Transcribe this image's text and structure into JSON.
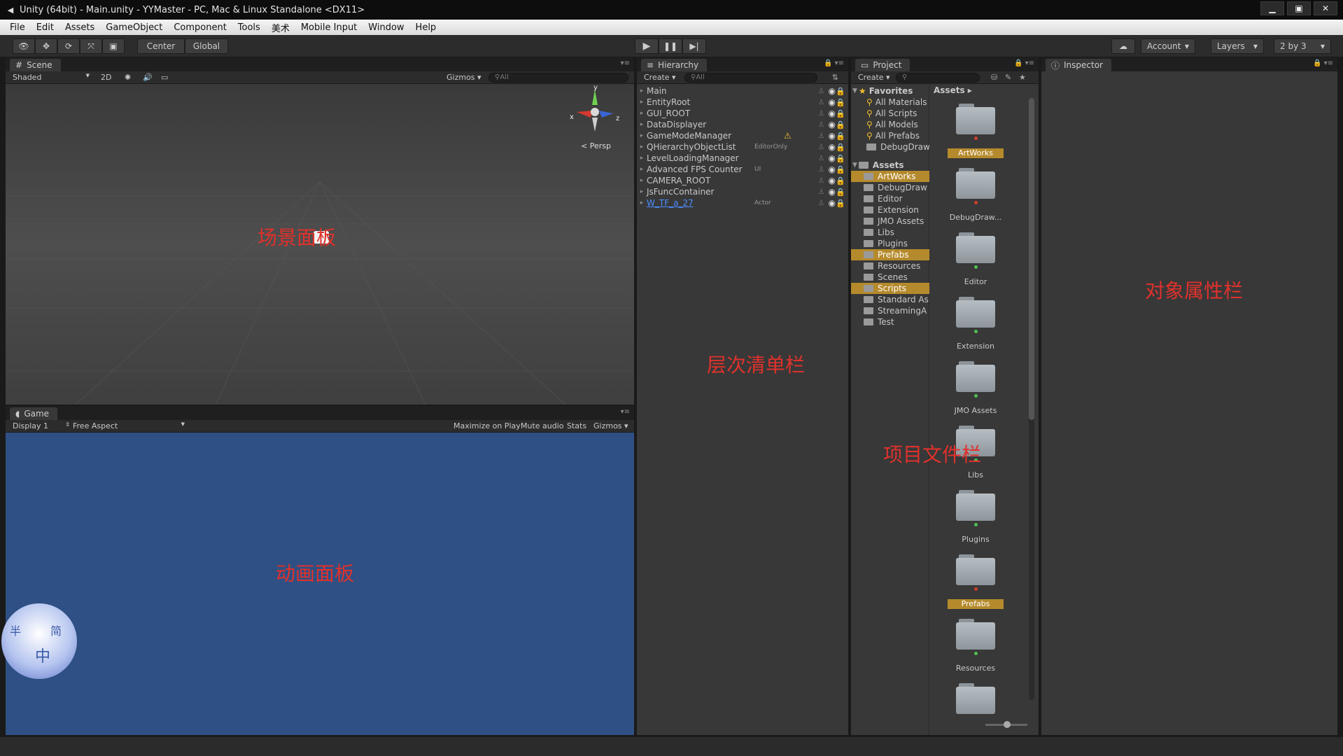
{
  "window": {
    "title": "Unity (64bit) - Main.unity - YYMaster - PC, Mac & Linux Standalone <DX11>"
  },
  "menu": [
    "File",
    "Edit",
    "Assets",
    "GameObject",
    "Component",
    "Tools",
    "美术",
    "Mobile Input",
    "Window",
    "Help"
  ],
  "toolbar": {
    "center": "Center",
    "global": "Global",
    "account": "Account",
    "layers": "Layers",
    "layout": "2 by 3"
  },
  "scene": {
    "tab": "Scene",
    "shading": "Shaded",
    "mode2d": "2D",
    "gizmos": "Gizmos",
    "search": "All",
    "persp": "Persp",
    "axis_x": "x",
    "axis_y": "y",
    "axis_z": "z",
    "overlay": "场景面板"
  },
  "game": {
    "tab": "Game",
    "display": "Display 1",
    "aspect": "Free Aspect",
    "maximize": "Maximize on Play",
    "mute": "Mute audio",
    "stats": "Stats",
    "gizmos": "Gizmos",
    "overlay": "动画面板",
    "ime_a": "中",
    "ime_b": "简",
    "ime_c": "半"
  },
  "hierarchy": {
    "tab": "Hierarchy",
    "create": "Create",
    "search": "All",
    "overlay": "层次清单栏",
    "items": [
      {
        "name": "Main",
        "tag": ""
      },
      {
        "name": "EntityRoot",
        "tag": ""
      },
      {
        "name": "GUI_ROOT",
        "tag": ""
      },
      {
        "name": "DataDisplayer",
        "tag": ""
      },
      {
        "name": "GameModeManager",
        "tag": ""
      },
      {
        "name": "QHierarchyObjectList",
        "tag": "EditorOnly"
      },
      {
        "name": "LevelLoadingManager",
        "tag": ""
      },
      {
        "name": "Advanced FPS Counter",
        "tag": "UI"
      },
      {
        "name": "CAMERA_ROOT",
        "tag": ""
      },
      {
        "name": "JsFuncContainer",
        "tag": ""
      },
      {
        "name": "W_TF_a_27",
        "tag": "Actor"
      }
    ]
  },
  "project": {
    "tab": "Project",
    "create": "Create",
    "overlay": "项目文件栏",
    "assets_header": "Assets",
    "favorites_label": "Favorites",
    "favorites": [
      "All Materials",
      "All Scripts",
      "All Models",
      "All Prefabs",
      "DebugDraw"
    ],
    "assets_label": "Assets",
    "tree": [
      {
        "name": "ArtWorks",
        "selected": true
      },
      {
        "name": "DebugDraw",
        "selected": false
      },
      {
        "name": "Editor",
        "selected": false
      },
      {
        "name": "Extension",
        "selected": false
      },
      {
        "name": "JMO Assets",
        "selected": false
      },
      {
        "name": "Libs",
        "selected": false
      },
      {
        "name": "Plugins",
        "selected": false
      },
      {
        "name": "Prefabs",
        "selected": true
      },
      {
        "name": "Resources",
        "selected": false
      },
      {
        "name": "Scenes",
        "selected": false
      },
      {
        "name": "Scripts",
        "selected": true
      },
      {
        "name": "Standard As",
        "selected": false
      },
      {
        "name": "StreamingA",
        "selected": false
      },
      {
        "name": "Test",
        "selected": false
      }
    ],
    "grid": [
      {
        "name": "ArtWorks",
        "selected": true,
        "status": "#d23c2c"
      },
      {
        "name": "DebugDraw...",
        "selected": false,
        "status": "#d23c2c"
      },
      {
        "name": "Editor",
        "selected": false,
        "status": "#4fc24f"
      },
      {
        "name": "Extension",
        "selected": false,
        "status": "#4fc24f"
      },
      {
        "name": "JMO Assets",
        "selected": false,
        "status": "#4fc24f"
      },
      {
        "name": "Libs",
        "selected": false,
        "status": "#4fc24f"
      },
      {
        "name": "Plugins",
        "selected": false,
        "status": "#4fc24f"
      },
      {
        "name": "Prefabs",
        "selected": true,
        "status": "#d23c2c"
      },
      {
        "name": "Resources",
        "selected": false,
        "status": "#4fc24f"
      },
      {
        "name": "",
        "selected": false,
        "status": ""
      }
    ]
  },
  "inspector": {
    "tab": "Inspector",
    "overlay": "对象属性栏"
  },
  "colors": {
    "accent": "#b58a2c",
    "game_bg": "#2e5084",
    "annotation": "#e0312c"
  }
}
